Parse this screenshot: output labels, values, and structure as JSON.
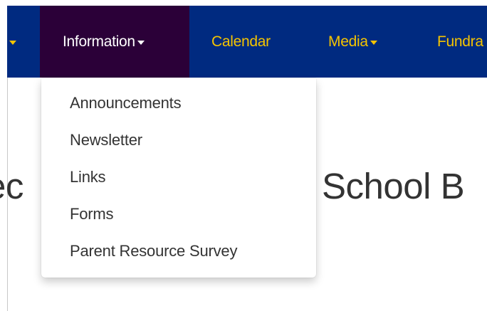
{
  "navbar": {
    "items": [
      {
        "label": "",
        "has_caret": true
      },
      {
        "label": "Information",
        "has_caret": true,
        "active": true
      },
      {
        "label": "Calendar",
        "has_caret": false
      },
      {
        "label": "Media",
        "has_caret": true
      },
      {
        "label": "Fundra",
        "has_caret": false
      }
    ],
    "colors": {
      "background": "#002a80",
      "active_background": "#2b0038",
      "link": "#f5c400",
      "active_link": "#ffffff"
    }
  },
  "dropdown": {
    "items": [
      {
        "label": "Announcements"
      },
      {
        "label": "Newsletter"
      },
      {
        "label": "Links"
      },
      {
        "label": "Forms"
      },
      {
        "label": "Parent Resource Survey"
      }
    ]
  },
  "page": {
    "heading_left_fragment": "ec",
    "heading_right_fragment": "School B"
  },
  "icons": {
    "caret": "caret-down-icon"
  }
}
